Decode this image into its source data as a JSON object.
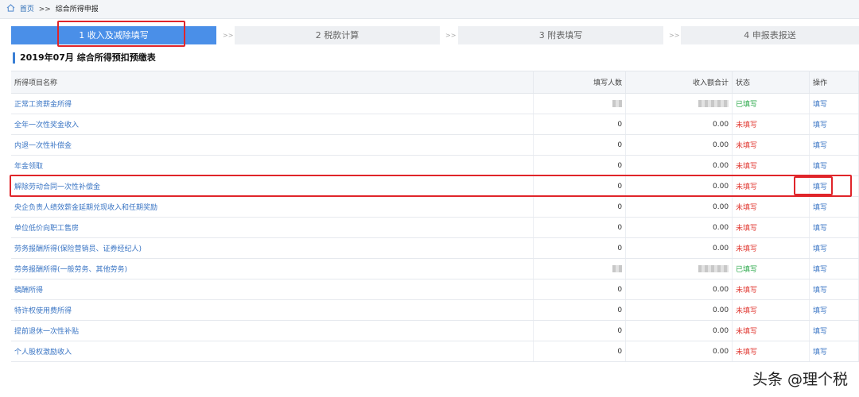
{
  "breadcrumb": {
    "home": "首页",
    "separator": ">>",
    "current": "综合所得申报"
  },
  "steps": [
    {
      "label": "1 收入及减除填写"
    },
    {
      "label": "2 税款计算"
    },
    {
      "label": "3 附表填写"
    },
    {
      "label": "4 申报表报送"
    }
  ],
  "step_arrow": ">>",
  "section_title": "2019年07月  综合所得预扣预缴表",
  "table": {
    "headers": {
      "name": "所得项目名称",
      "count": "填写人数",
      "income": "收入额合计",
      "status": "状态",
      "op": "操作"
    },
    "rows": [
      {
        "name": "正常工资薪金所得",
        "count": "",
        "income": "",
        "status": "已填写",
        "op": "填写"
      },
      {
        "name": "全年一次性奖金收入",
        "count": "0",
        "income": "0.00",
        "status": "未填写",
        "op": "填写"
      },
      {
        "name": "内退一次性补偿金",
        "count": "0",
        "income": "0.00",
        "status": "未填写",
        "op": "填写"
      },
      {
        "name": "年金领取",
        "count": "0",
        "income": "0.00",
        "status": "未填写",
        "op": "填写"
      },
      {
        "name": "解除劳动合同一次性补偿金",
        "count": "0",
        "income": "0.00",
        "status": "未填写",
        "op": "填写"
      },
      {
        "name": "央企负责人绩效薪金延期兑现收入和任期奖励",
        "count": "0",
        "income": "0.00",
        "status": "未填写",
        "op": "填写"
      },
      {
        "name": "单位低价向职工售房",
        "count": "0",
        "income": "0.00",
        "status": "未填写",
        "op": "填写"
      },
      {
        "name": "劳务报酬所得(保险营销员、证券经纪人)",
        "count": "0",
        "income": "0.00",
        "status": "未填写",
        "op": "填写"
      },
      {
        "name": "劳务报酬所得(一般劳务、其他劳务)",
        "count": "",
        "income": "",
        "status": "已填写",
        "op": "填写"
      },
      {
        "name": "稿酬所得",
        "count": "0",
        "income": "0.00",
        "status": "未填写",
        "op": "填写"
      },
      {
        "name": "特许权使用费所得",
        "count": "0",
        "income": "0.00",
        "status": "未填写",
        "op": "填写"
      },
      {
        "name": "提前退休一次性补贴",
        "count": "0",
        "income": "0.00",
        "status": "未填写",
        "op": "填写"
      },
      {
        "name": "个人股权激励收入",
        "count": "0",
        "income": "0.00",
        "status": "未填写",
        "op": "填写"
      }
    ]
  },
  "watermark": "头条 @理个税",
  "colors": {
    "accent": "#4a8fe8",
    "done": "#2aa84a",
    "todo": "#e0362f",
    "link": "#3a75c4",
    "highlight": "#e0252a"
  },
  "icons": {
    "home": "home-icon"
  }
}
